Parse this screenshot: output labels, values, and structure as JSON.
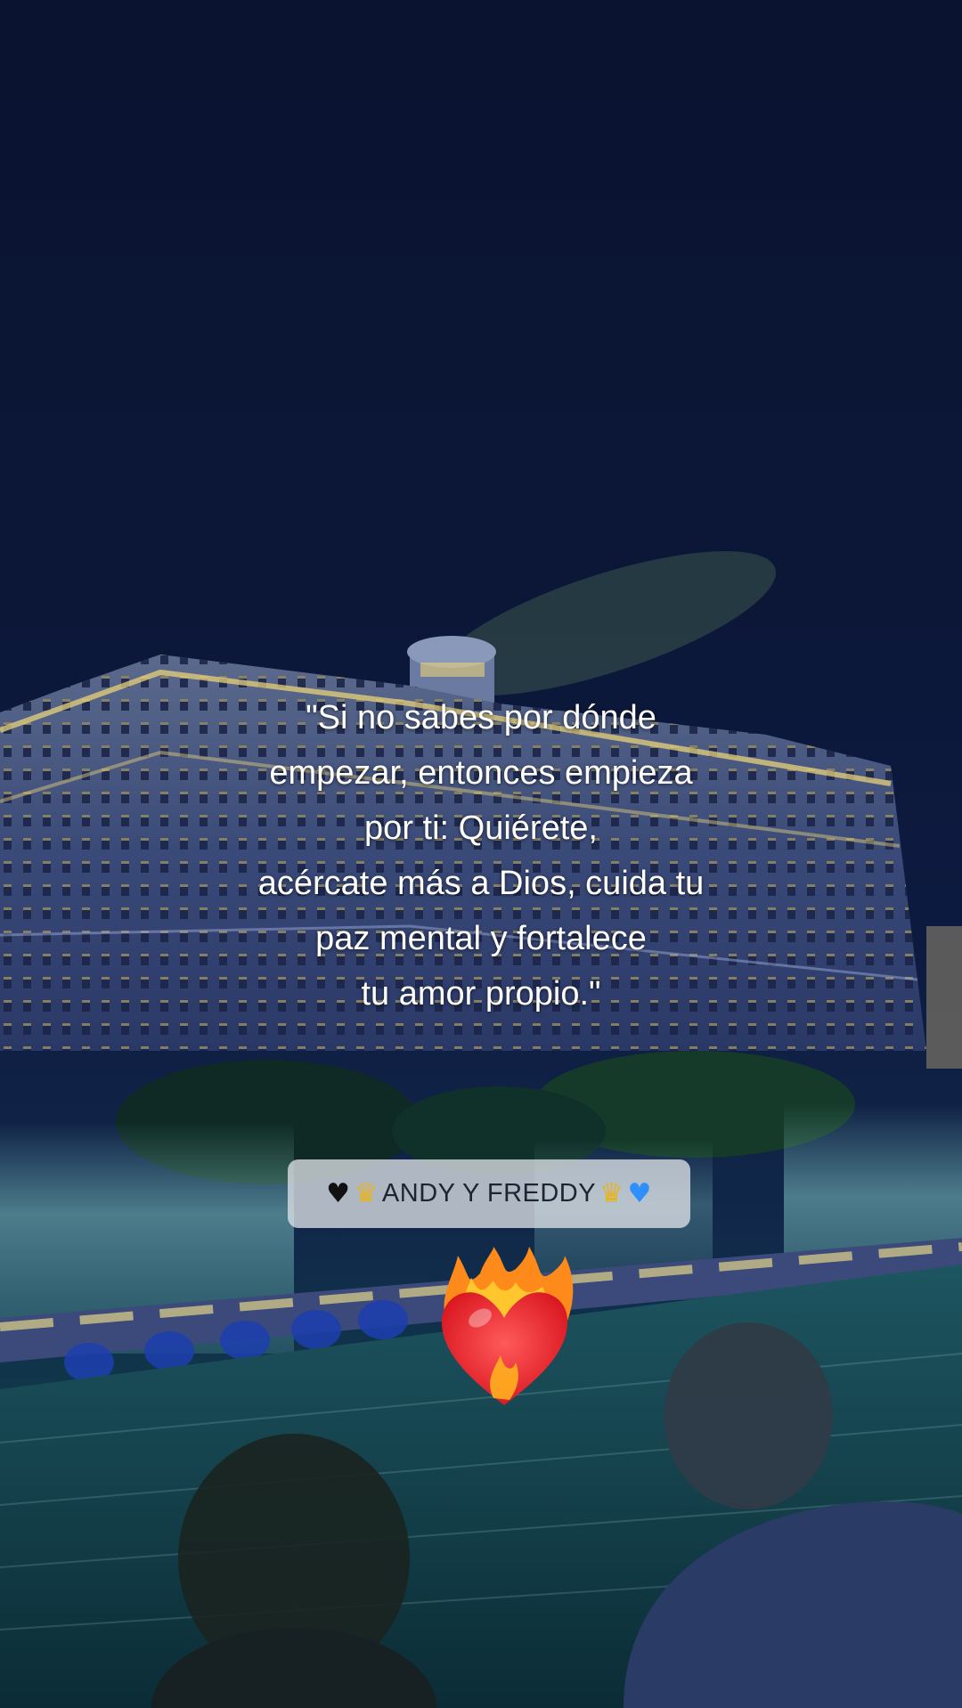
{
  "quote": {
    "lines": [
      "\"Si no sabes por dónde",
      "empezar, entonces empieza",
      "por ti: Quiérete,",
      "acércate más a Dios, cuida tu",
      "paz mental y fortalece",
      "tu amor propio.\""
    ]
  },
  "signature": {
    "text": "ANDY Y FREDDY",
    "leading_icons": [
      "black-heart-icon",
      "crown-icon"
    ],
    "trailing_icons": [
      "crown-icon",
      "blue-heart-icon"
    ]
  },
  "sticker": {
    "icon": "heart-on-fire-icon"
  },
  "colors": {
    "sky": "#0b1430",
    "water": "#0f3c4a",
    "building_lights": "#e8d27a",
    "chip_background": "#dce0e6"
  }
}
